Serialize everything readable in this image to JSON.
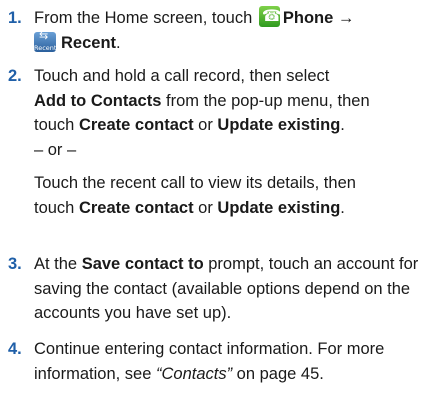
{
  "steps": [
    {
      "num": "1.",
      "pre": "From the Home screen, touch",
      "phone": "Phone",
      "arrow": "→",
      "recent_icon_label": "Recent",
      "recent": "Recent",
      "end": "."
    },
    {
      "num": "2.",
      "a1": "Touch and hold a call record, then select",
      "a2b": "Add to Contacts",
      "a2": " from the pop-up menu, then",
      "a3": "touch ",
      "a3b1": "Create contact",
      "a3m": " or ",
      "a3b2": "Update existing",
      "a3e": ".",
      "or": "– or –",
      "b1": "Touch the recent call to view its details, then",
      "b2": "touch ",
      "b2b1": "Create contact",
      "b2m": " or ",
      "b2b2": "Update existing",
      "b2e": "."
    },
    {
      "num": "3.",
      "pre": "At the ",
      "bold": "Save contact to",
      "l1": " prompt, touch an account for",
      "l2": "saving the contact (available options depend on the",
      "l3": "accounts you have set up)."
    },
    {
      "num": "4.",
      "l1": "Continue entering contact information. For more",
      "l2pre": "information, see ",
      "l2i": "“Contacts”",
      "l2post": " on page 45."
    }
  ],
  "icons": {
    "phone": "phone-icon",
    "recent": "recent-calls-icon"
  },
  "colors": {
    "step_number": "#1f5fa8",
    "phone_icon": "#4cb52e",
    "recent_icon": "#3a74b8"
  }
}
